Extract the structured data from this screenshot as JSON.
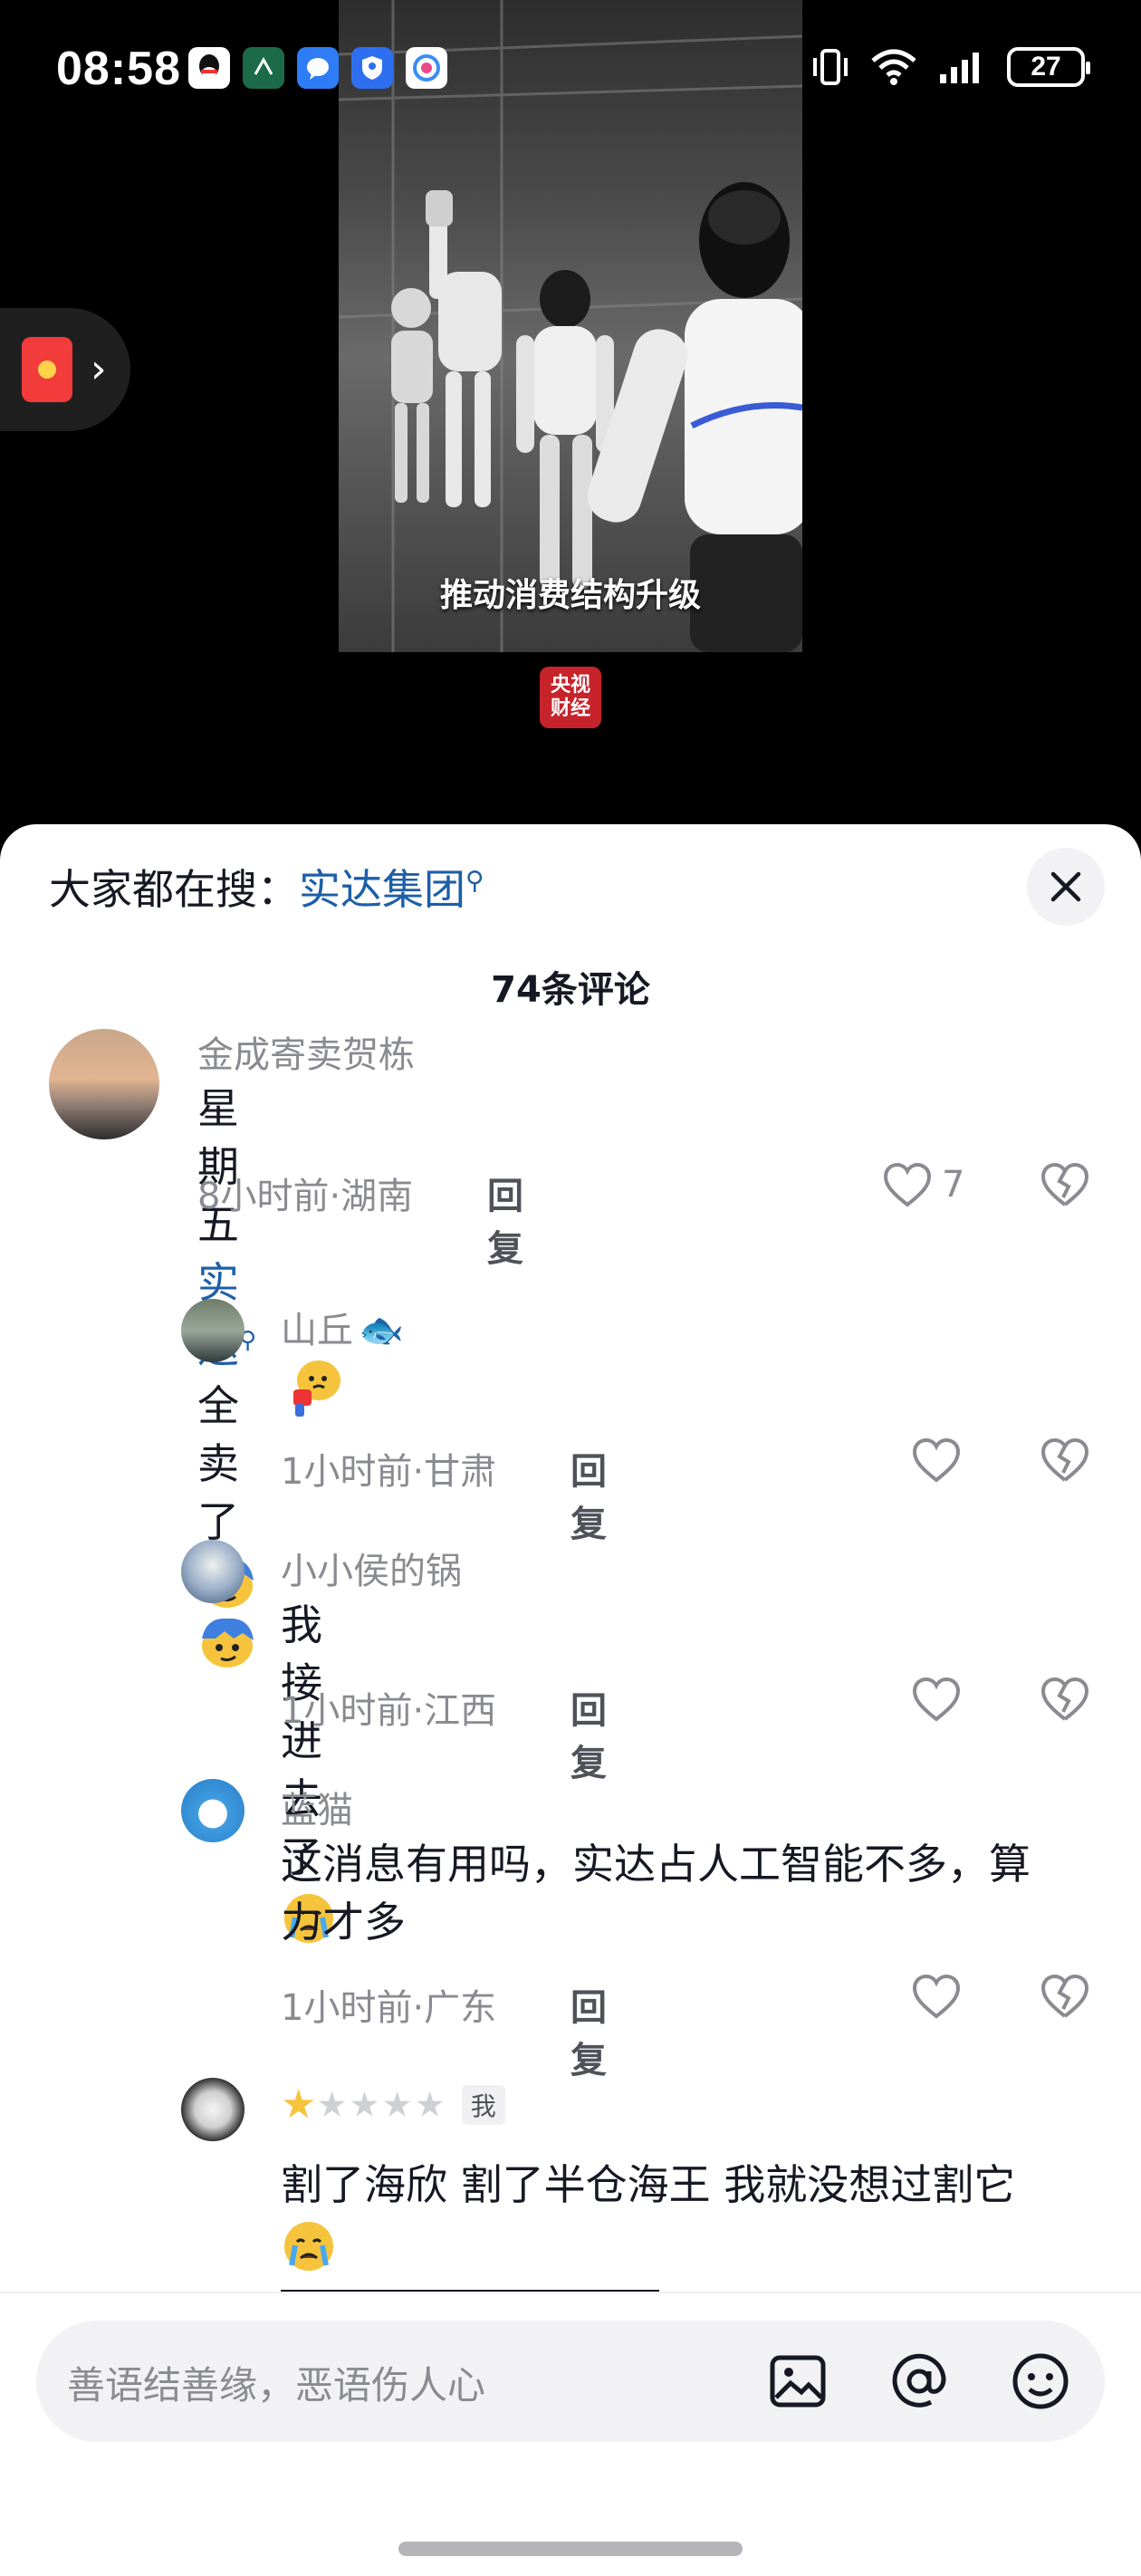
{
  "status_bar": {
    "time": "08:58",
    "battery": "27",
    "notification_icons": [
      "qq-icon",
      "app-icon",
      "messages-icon",
      "security-icon",
      "browser-icon"
    ],
    "system_icons": [
      "vibrate-icon",
      "wifi-icon",
      "signal-icon",
      "battery-icon"
    ]
  },
  "video": {
    "caption": "推动消费结构升级",
    "logo_text_line1": "央视",
    "logo_text_line2": "财经"
  },
  "sheet": {
    "search_prefix": "大家都在搜：",
    "search_keyword": "实达集团",
    "comment_count": "74条评论",
    "comments": [
      {
        "name": "金成寄卖贺栋",
        "text_before": "星期五",
        "keyword": "实达",
        "text_after": "全卖了",
        "meta": "8小时前·湖南",
        "reply": "回复",
        "likes": "7"
      },
      {
        "name": "山丘",
        "text": "",
        "meta": "1小时前·甘肃",
        "reply": "回复"
      },
      {
        "name": "小小侯的锅",
        "text": "我接进去了",
        "meta": "1小时前·江西",
        "reply": "回复"
      },
      {
        "name": "蓝猫",
        "text": "这消息有用吗，实达占人工智能不多，算力才多",
        "meta": "1小时前·广东",
        "reply": "回复"
      },
      {
        "name": "",
        "tag": "我",
        "text": "割了海欣 割了半仓海王 我就没想过割它"
      }
    ]
  },
  "input": {
    "placeholder": "善语结善缘，恶语伤人心"
  },
  "colors": {
    "keyword_blue": "#1d5fa8",
    "muted_text": "#8a8b91",
    "primary_text": "#161823"
  }
}
